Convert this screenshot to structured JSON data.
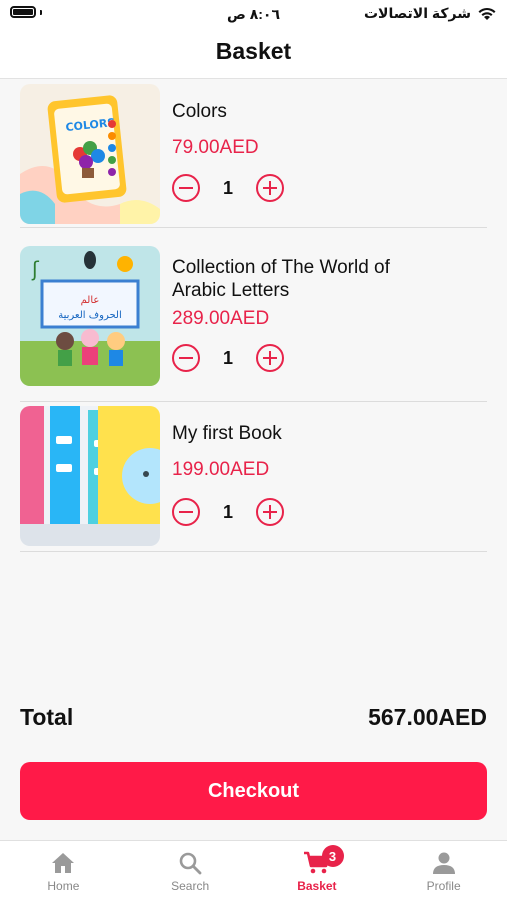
{
  "status_bar": {
    "time": "٨:٠٦ ص",
    "carrier": "شركة الاتصالات"
  },
  "header": {
    "title": "Basket"
  },
  "items": [
    {
      "name": "Colors",
      "price": "79.00AED",
      "quantity": "1",
      "image": "colors-book-thumbnail"
    },
    {
      "name": "Collection of The World of Arabic Letters",
      "price": "289.00AED",
      "quantity": "1",
      "image": "arabic-letters-book-thumbnail"
    },
    {
      "name": "My first Book",
      "price": "199.00AED",
      "quantity": "1",
      "image": "first-book-thumbnail"
    }
  ],
  "summary": {
    "total_label": "Total",
    "total_value": "567.00AED"
  },
  "checkout_label": "Checkout",
  "tabs": [
    {
      "label": "Home",
      "icon": "home-icon"
    },
    {
      "label": "Search",
      "icon": "search-icon"
    },
    {
      "label": "Basket",
      "icon": "cart-icon",
      "badge": "3",
      "active": true
    },
    {
      "label": "Profile",
      "icon": "profile-icon"
    }
  ],
  "colors": {
    "accent": "#e8234a",
    "checkout": "#ff1a48"
  }
}
